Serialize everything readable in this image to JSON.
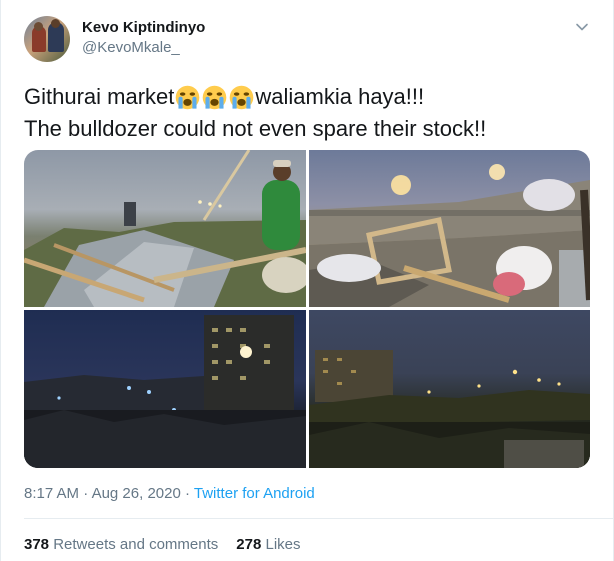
{
  "user": {
    "name": "Kevo Kiptindinyo",
    "handle": "@KevoMkale_"
  },
  "tweet": {
    "text_part1": "Githurai market",
    "text_part2": "waliamkia haya!!!",
    "text_line2": "The bulldozer could not even spare their stock!!",
    "emoji": [
      "crying-face-emoji",
      "crying-face-emoji",
      "crying-face-emoji"
    ],
    "photos": [
      "demolished-market-stalls-photo",
      "bridge-debris-dusk-photo",
      "night-buildings-photo",
      "night-cityscape-photo"
    ]
  },
  "meta": {
    "time": "8:17 AM",
    "separator": "·",
    "date": "Aug 26, 2020",
    "client": "Twitter for Android"
  },
  "stats": {
    "retweets_count": "378",
    "retweets_label": "Retweets and comments",
    "likes_count": "278",
    "likes_label": "Likes"
  },
  "colors": {
    "link": "#1da1f2",
    "secondary_text": "#657786",
    "primary_text": "#14171a",
    "divider": "#e6ecf0"
  }
}
